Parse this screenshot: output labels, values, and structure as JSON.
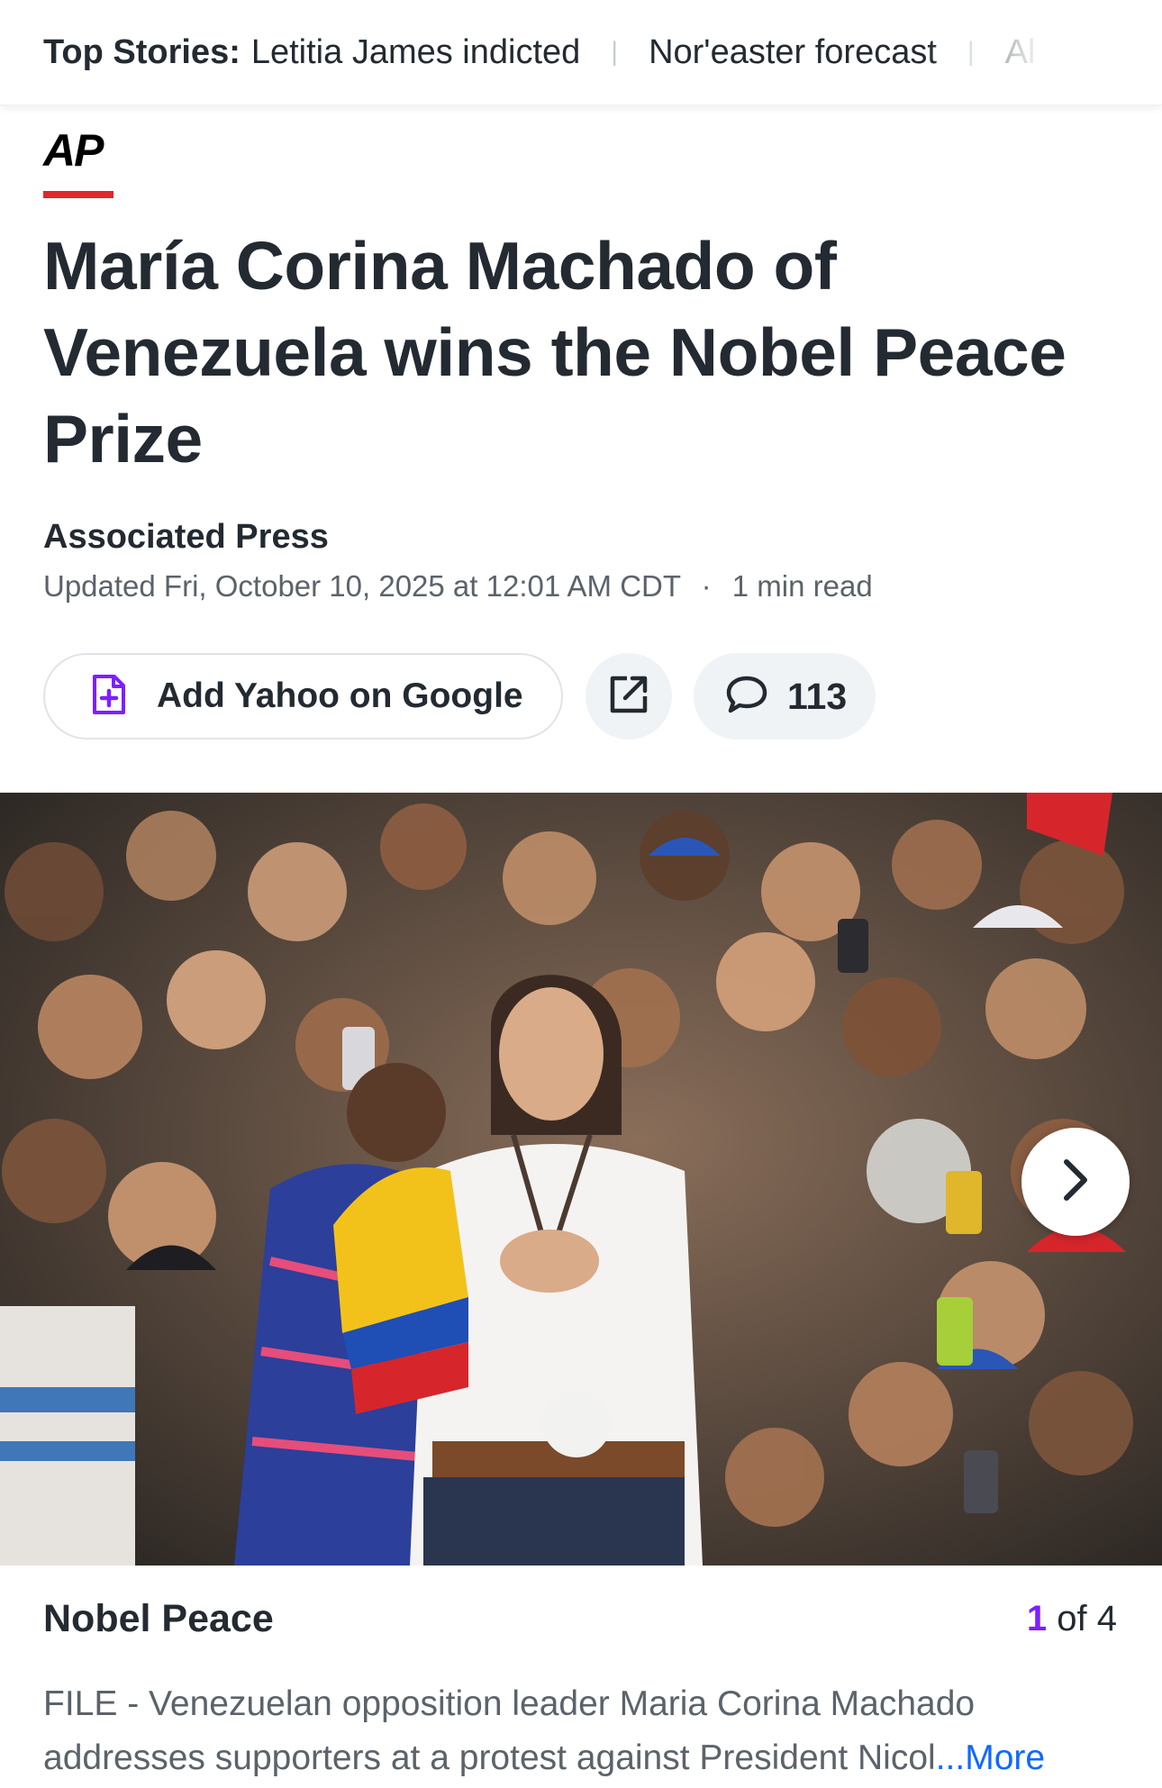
{
  "ticker": {
    "label": "Top Stories:",
    "stories": [
      "Letitia James indicted",
      "Nor'easter forecast",
      "Al"
    ]
  },
  "publisher": {
    "logo_text": "AP"
  },
  "article": {
    "headline": "María Corina Machado of Venezuela wins the Nobel Peace Prize",
    "author": "Associated Press",
    "updated": "Updated Fri, October 10, 2025 at 12:01 AM CDT",
    "separator": "·",
    "read_time": "1 min read"
  },
  "actions": {
    "add_google_label": "Add Yahoo on Google",
    "comments_count": "113"
  },
  "gallery": {
    "caption_title": "Nobel Peace",
    "current": "1",
    "total_text": "of 4",
    "caption_line1": "FILE - Venezuelan opposition leader Maria Corina Machado",
    "caption_line2": "addresses supporters at a protest against President Nicol",
    "ellipsis": "...",
    "more_label": "More"
  },
  "colors": {
    "accent_purple": "#7e1fff",
    "link_blue": "#0f69ff",
    "ap_red": "#e4252b",
    "text_dark": "#232a31",
    "text_muted": "#5b636a"
  },
  "icons": {
    "add_google": "document-plus-icon",
    "share": "external-link-icon",
    "comments": "speech-bubble-icon",
    "next": "chevron-right-icon"
  }
}
